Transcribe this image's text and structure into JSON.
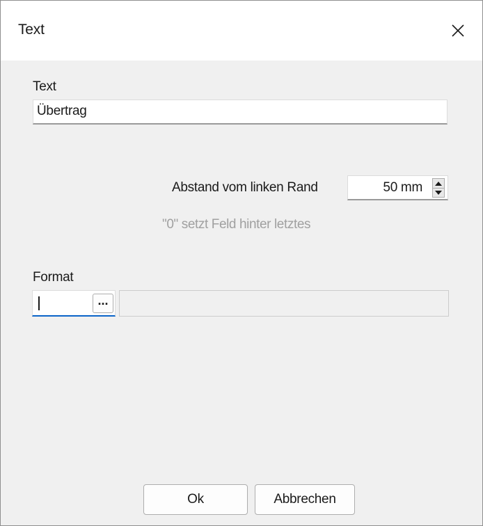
{
  "dialog": {
    "title": "Text",
    "close_icon": "close-icon"
  },
  "text_field": {
    "label": "Text",
    "value": "Übertrag"
  },
  "margin_field": {
    "label": "Abstand vom linken Rand",
    "value": "50 mm",
    "hint": "\"0\" setzt Feld hinter letztes"
  },
  "format_field": {
    "label": "Format",
    "value": "",
    "browse_label": "...",
    "display_value": ""
  },
  "buttons": {
    "ok_label": "Ok",
    "cancel_label": "Abbrechen"
  }
}
